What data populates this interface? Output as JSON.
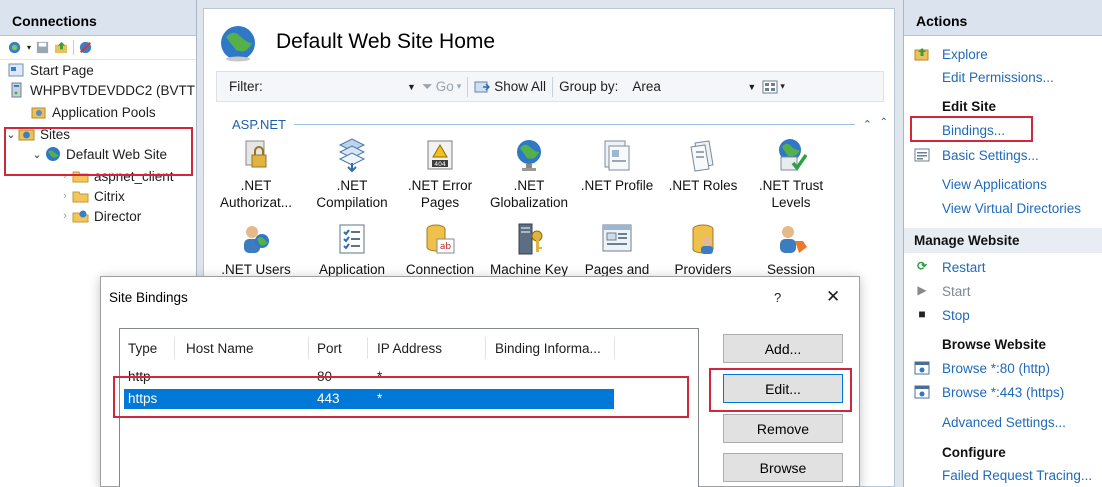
{
  "connections": {
    "title": "Connections",
    "tree": [
      {
        "label": "Start Page",
        "icon": "start-page-icon"
      },
      {
        "label": "WHPBVTDEVDDC2 (BVTT",
        "icon": "server-icon"
      },
      {
        "label": "Application Pools",
        "icon": "app-pools-icon"
      },
      {
        "label": "Sites",
        "icon": "sites-folder-icon"
      },
      {
        "label": "Default Web Site",
        "icon": "globe-icon"
      },
      {
        "label": "aspnet_client",
        "icon": "folder-icon"
      },
      {
        "label": "Citrix",
        "icon": "folder-icon"
      },
      {
        "label": "Director",
        "icon": "app-icon"
      }
    ]
  },
  "center": {
    "title": "Default Web Site Home",
    "filter_label": "Filter:",
    "filter_value": "",
    "go_label": "Go",
    "show_all_label": "Show All",
    "group_by_label": "Group by:",
    "group_by_value": "Area",
    "section_label": "ASP.NET",
    "features_row1": [
      {
        "line1": ".NET",
        "line2": "Authorizat...",
        "icon": "lock-doc-icon"
      },
      {
        "line1": ".NET",
        "line2": "Compilation",
        "icon": "compile-icon"
      },
      {
        "line1": ".NET Error",
        "line2": "Pages",
        "icon": "error-404-icon"
      },
      {
        "line1": ".NET",
        "line2": "Globalization",
        "icon": "globe-icon"
      },
      {
        "line1": ".NET Profile",
        "line2": "",
        "icon": "profile-icon"
      },
      {
        "line1": ".NET Roles",
        "line2": "",
        "icon": "roles-icon"
      },
      {
        "line1": ".NET Trust",
        "line2": "Levels",
        "icon": "trust-icon"
      }
    ],
    "features_row2": [
      {
        "line1": ".NET Users",
        "icon": "users-icon"
      },
      {
        "line1": "Application",
        "icon": "app-settings-icon"
      },
      {
        "line1": "Connection",
        "icon": "db-connection-icon"
      },
      {
        "line1": "Machine Key",
        "icon": "machine-key-icon"
      },
      {
        "line1": "Pages and",
        "icon": "pages-icon"
      },
      {
        "line1": "Providers",
        "icon": "providers-icon"
      },
      {
        "line1": "Session State",
        "icon": "session-icon"
      }
    ]
  },
  "actions": {
    "title": "Actions",
    "explore": "Explore",
    "edit_permissions": "Edit Permissions...",
    "edit_site": "Edit Site",
    "bindings": "Bindings...",
    "basic_settings": "Basic Settings...",
    "view_applications": "View Applications",
    "view_virtual_dirs": "View Virtual Directories",
    "manage_website": "Manage Website",
    "restart": "Restart",
    "start": "Start",
    "stop": "Stop",
    "browse_website": "Browse Website",
    "browse_80": "Browse *:80 (http)",
    "browse_443": "Browse *:443 (https)",
    "advanced_settings": "Advanced Settings...",
    "configure": "Configure",
    "failed_request": "Failed Request Tracing..."
  },
  "dialog": {
    "title": "Site Bindings",
    "help": "?",
    "close": "✕",
    "columns": [
      "Type",
      "Host Name",
      "Port",
      "IP Address",
      "Binding Informa..."
    ],
    "rows": [
      {
        "type": "http",
        "host": "",
        "port": "80",
        "ip": "*",
        "info": ""
      },
      {
        "type": "https",
        "host": "",
        "port": "443",
        "ip": "*",
        "info": ""
      }
    ],
    "selected_row": "https",
    "buttons": {
      "add": "Add...",
      "edit": "Edit...",
      "remove": "Remove",
      "browse": "Browse"
    }
  },
  "colors": {
    "highlight": "#d1263b",
    "selection": "#0078d7",
    "link": "#1f6ab8"
  }
}
